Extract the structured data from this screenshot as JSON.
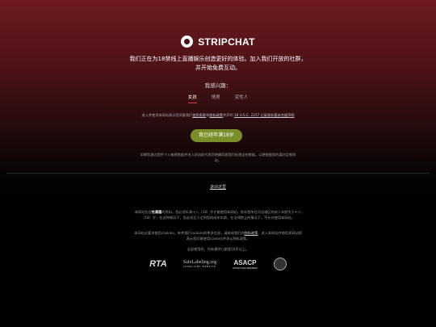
{
  "brand": {
    "name": "STRIPCHAT"
  },
  "headline": "我们正在为18禁线上直播娱乐创造更好的体验。加入我们开放的社群，并开始免费互动。",
  "interest": {
    "title": "我感兴趣：",
    "tabs": [
      {
        "label": "女孩",
        "active": true
      },
      {
        "label": "情男",
        "active": false
      },
      {
        "label": "变性人",
        "active": false
      }
    ]
  },
  "terms": {
    "prefix": "进入并使用本网站表示您同意我们",
    "tos_link": "使用条款",
    "and": "和",
    "privacy_link": "隐私政策",
    "middle": "并声明",
    "usc_link": "18 U.S.C. 2257 记录保存要求合规声明"
  },
  "age_button": "我已经年满18岁",
  "disclaimer": "如果您通过提供个人敏感数据并进入网站即代表您明确同意我们处理这些数据，以便根据您的喜好定制网站。",
  "exit_link": "退出这里",
  "notice": {
    "prefix": "本网站包含",
    "bold": "性暴露",
    "body": "的资料。您必须年满十八（18）岁才能使用本网站，除非您所在司法辖区的成人年龄大于十八（18）岁，在这种情况下，您必须至少达到您的成年年龄。在法律禁止的情况下，不允许使用本网站。"
  },
  "cookie": {
    "prefix": "本网站还要求使用cookies。有关我们cookies的更多信息，请参阅我们的",
    "link": "隐私政策",
    "suffix": "。进入本网站并使用本网站即表示您同意使用cookies并承认隐私政策。"
  },
  "age_requirement": "全部使用时，所有模特儿都是18岁以上。",
  "badges": {
    "rta": "RTA",
    "safelabeling": "SafeLabeling.org",
    "safelabeling_sub": "COMPLIANT WEBSITE",
    "asacp": "ASACP",
    "asacp_sub": "APPROVED MEMBER"
  },
  "colors": {
    "accent_button": "#7a8f2a",
    "tab_underline": "#e03a3a"
  }
}
